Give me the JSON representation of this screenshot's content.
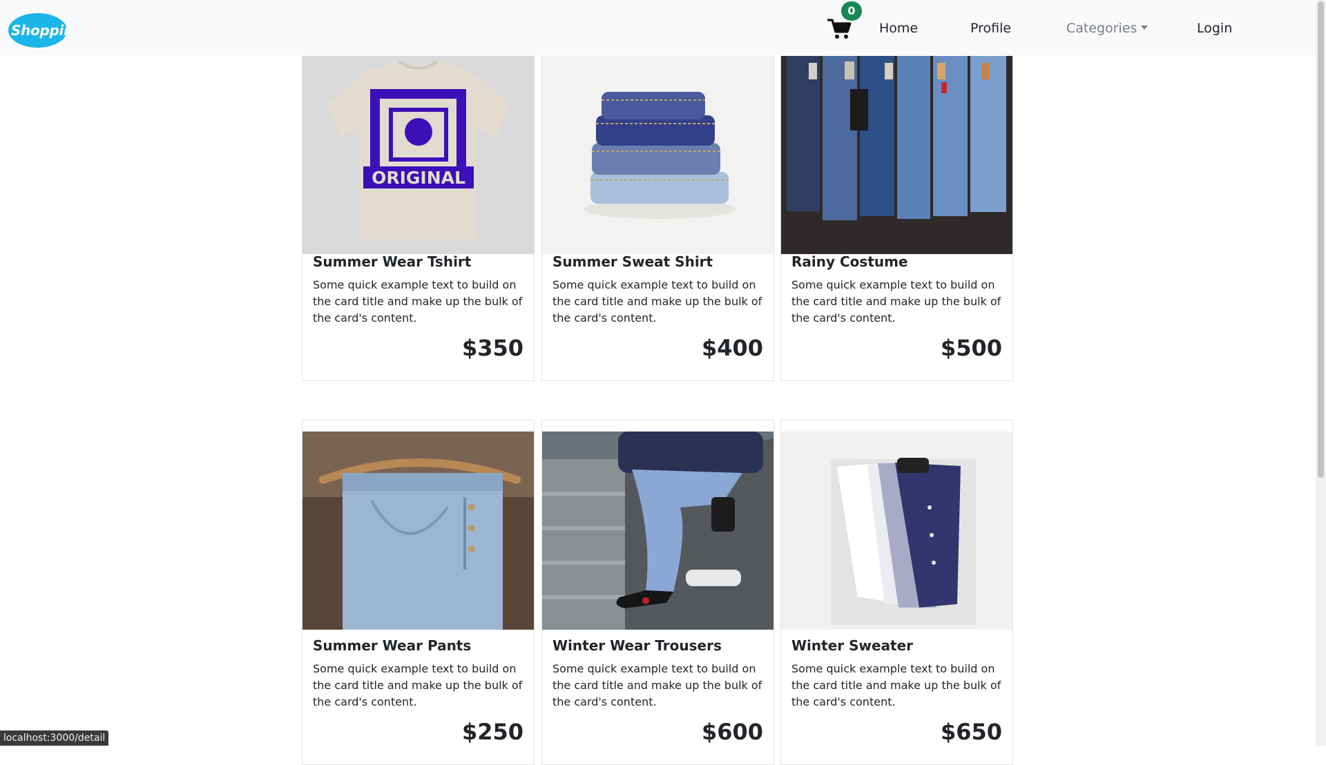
{
  "brand": {
    "logo_text": "Shopping",
    "color": "#1ab6e8"
  },
  "cart": {
    "icon": "shopping-cart-icon",
    "count": "0",
    "badge_color": "#198754"
  },
  "nav": {
    "home": "Home",
    "profile": "Profile",
    "categories": "Categories",
    "login": "Login"
  },
  "products": [
    {
      "title": "Summer Wear Tshirt",
      "text": "Some quick example text to build on the card title and make up the bulk of the card's content.",
      "price": "$350"
    },
    {
      "title": "Summer Sweat Shirt",
      "text": "Some quick example text to build on the card title and make up the bulk of the card's content.",
      "price": "$400"
    },
    {
      "title": "Rainy Costume",
      "text": "Some quick example text to build on the card title and make up the bulk of the card's content.",
      "price": "$500"
    },
    {
      "title": "Summer Wear Pants",
      "text": "Some quick example text to build on the card title and make up the bulk of the card's content.",
      "price": "$250"
    },
    {
      "title": "Winter Wear Trousers",
      "text": "Some quick example text to build on the card title and make up the bulk of the card's content.",
      "price": "$600"
    },
    {
      "title": "Winter Sweater",
      "text": "Some quick example text to build on the card title and make up the bulk of the card's content.",
      "price": "$650"
    }
  ],
  "status_bar": {
    "url": "localhost:3000/detail"
  }
}
